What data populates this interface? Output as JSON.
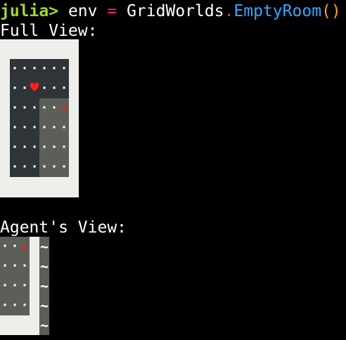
{
  "repl": {
    "prompt": "julia>",
    "variable": "env",
    "assign_op": "=",
    "module": "GridWorlds",
    "dot": ".",
    "constructor": "EmptyRoom",
    "parens": "()"
  },
  "full_view": {
    "label": "Full View:",
    "rows": 6,
    "cols": 6,
    "dot_glyph": "·",
    "goal_glyph": "♥",
    "agent_glyph": "↓",
    "goal_position": {
      "row": 1,
      "col": 2
    },
    "agent_position": {
      "row": 2,
      "col": 5
    },
    "view_region": {
      "row_start": 2,
      "row_end": 5,
      "col_start": 3,
      "col_end": 5
    }
  },
  "agent_view": {
    "label": "Agent's View:",
    "rows": 5,
    "cols": 4,
    "dot_glyph": "·",
    "agent_glyph": "↓",
    "unknown_glyph": "~",
    "agent_position": {
      "row": 0,
      "col": 2
    }
  },
  "colors": {
    "prompt": "#9fd92f",
    "operator": "#ff2a5a",
    "method": "#31a7ff",
    "paren": "#f3a600",
    "wall_cell": "#2f3437",
    "visible_cell": "#5d5e57",
    "frame": "#eeeeea",
    "heart": "#ff1f1f",
    "arrow": "#ff2020"
  }
}
